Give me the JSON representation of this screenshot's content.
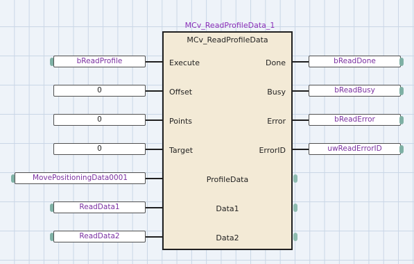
{
  "instance_name": "MCv_ReadProfileData_1",
  "fb_type": "MCv_ReadProfileData",
  "inputs": [
    {
      "pin": "Execute",
      "var": "bReadProfile",
      "is_constant": false
    },
    {
      "pin": "Offset",
      "var": "0",
      "is_constant": true
    },
    {
      "pin": "Points",
      "var": "0",
      "is_constant": true
    },
    {
      "pin": "Target",
      "var": "0",
      "is_constant": true
    }
  ],
  "outputs": [
    {
      "pin": "Done",
      "var": "bReadDone"
    },
    {
      "pin": "Busy",
      "var": "bReadBusy"
    },
    {
      "pin": "Error",
      "var": "bReadError"
    },
    {
      "pin": "ErrorID",
      "var": "uwReadErrorID"
    }
  ],
  "inouts": [
    {
      "pin": "ProfileData",
      "var": "MovePositioningData0001"
    },
    {
      "pin": "Data1",
      "var": "ReadData1"
    },
    {
      "pin": "Data2",
      "var": "ReadData2"
    }
  ],
  "colors": {
    "grid_background": "#eef3f9",
    "grid_lines": "#c9d6e6",
    "fb_fill": "#f3ead6",
    "variable_text": "#7a2fa0",
    "instance_text": "#8b2fb8",
    "connector": "#7fb1a5"
  }
}
